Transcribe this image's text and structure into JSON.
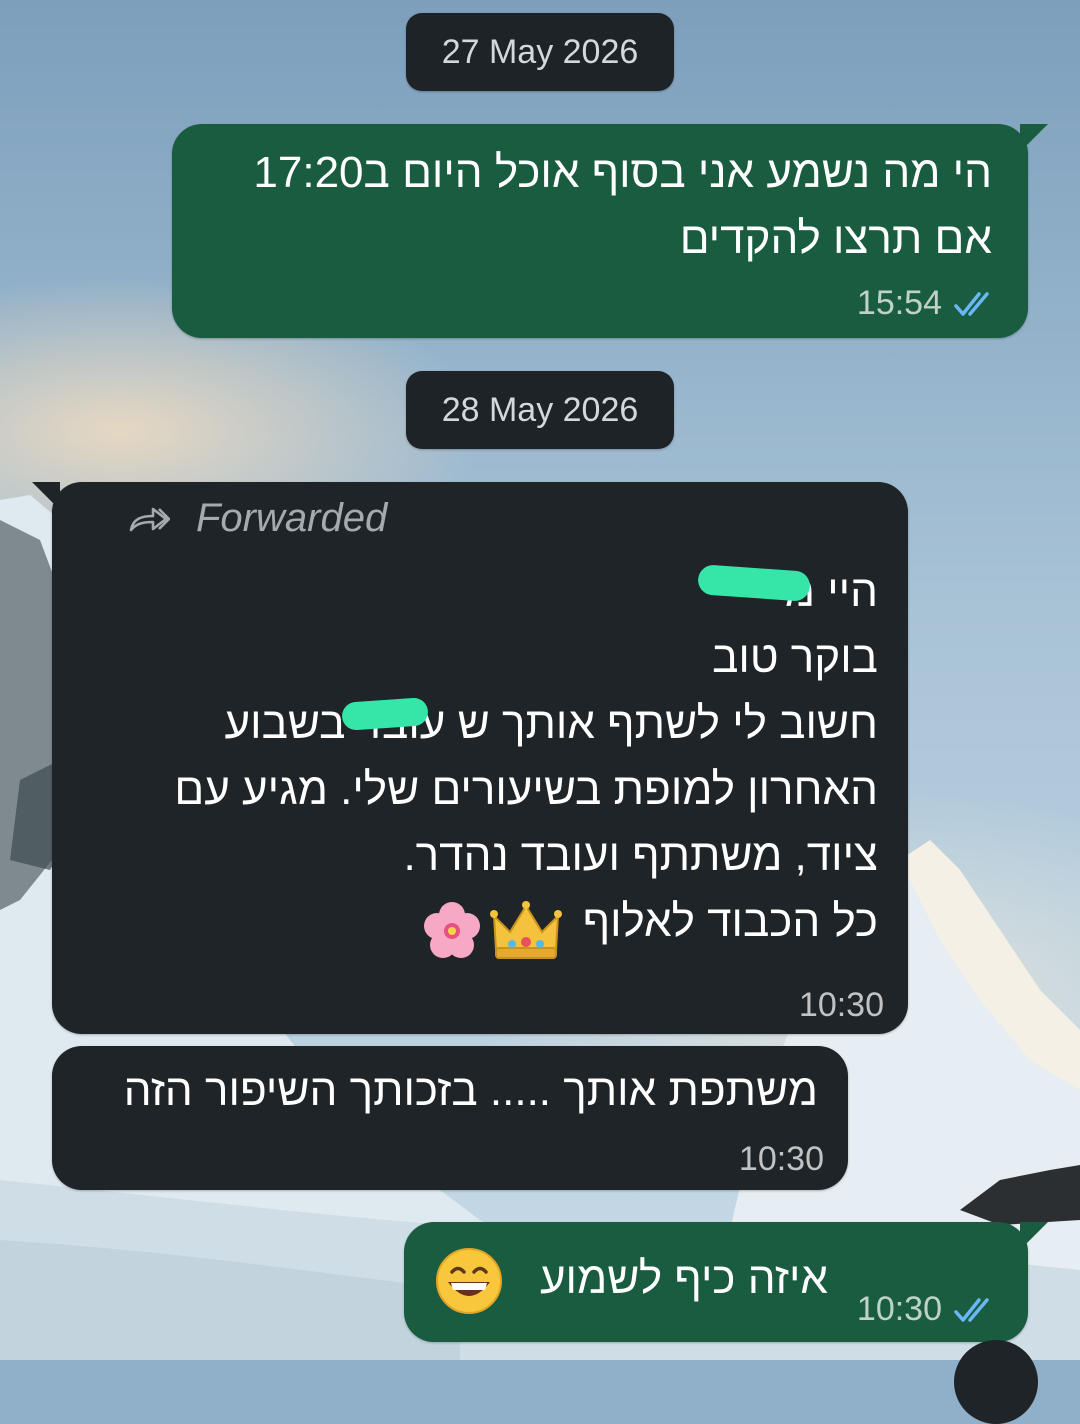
{
  "chat": {
    "date_chips": [
      "27 May 2026",
      "28 May 2026"
    ],
    "messages": [
      {
        "direction": "outgoing",
        "text": "הי מה נשמע אני בסוף אוכל היום ב17:20\nאם תרצו להקדים",
        "time": "15:54",
        "status": "read"
      },
      {
        "direction": "incoming",
        "forwarded_label": "Forwarded",
        "text": "היי מ\nבוקר טוב\nחשוב לי לשתף אותך ש   עובד בשבוע\nהאחרון למופת בשיעורים שלי. מגיע עם\nציוד, משתתף ועובד נהדר.\nכל הכבוד לאלוף",
        "emojis": [
          "crown",
          "cherry-blossom"
        ],
        "time": "10:30"
      },
      {
        "direction": "incoming",
        "text": "משתפת אותך ..... בזכותך השיפור הזה",
        "time": "10:30"
      },
      {
        "direction": "outgoing",
        "text": "איזה כיף לשמוע",
        "emojis": [
          "grinning-face"
        ],
        "time": "10:30",
        "status": "read"
      }
    ]
  },
  "icons": {
    "forward": "forward-arrow-icon",
    "read_receipt": "double-check-icon"
  },
  "colors": {
    "outgoing_bubble": "#1a5c40",
    "incoming_bubble": "#1f2428",
    "date_chip": "#1e2328",
    "read_ticks": "#6ab7f5",
    "redaction_marker": "#36e6a9"
  }
}
